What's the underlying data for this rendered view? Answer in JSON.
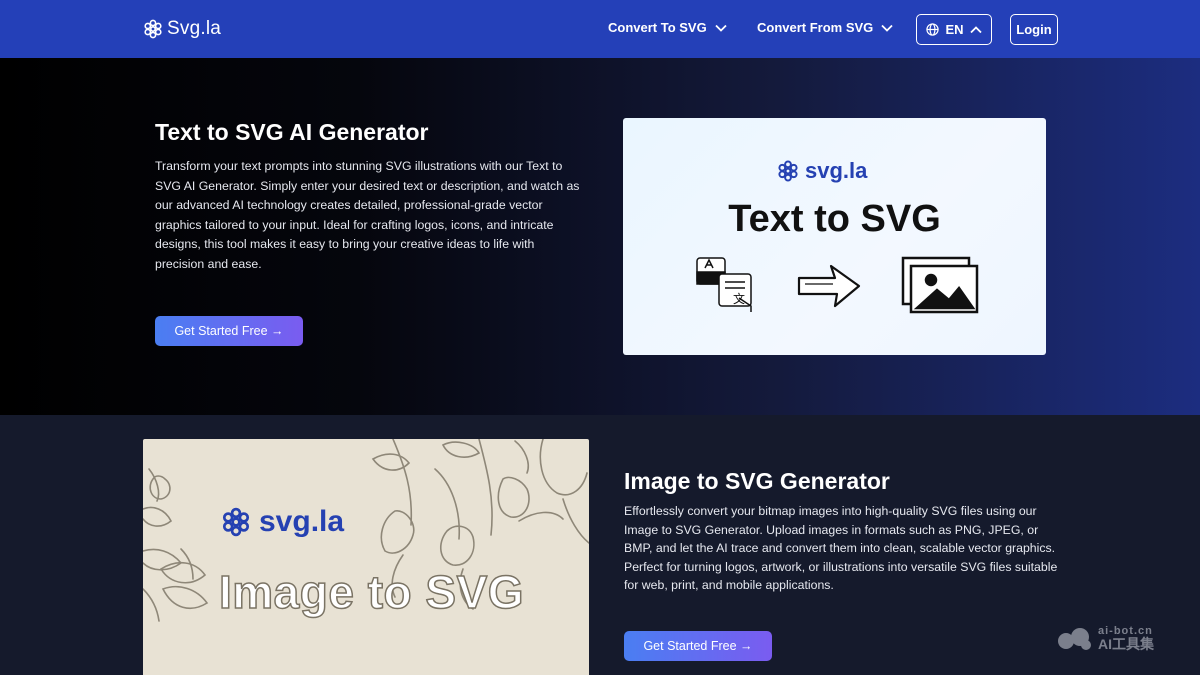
{
  "nav": {
    "logo_text": "Svg.la",
    "convert_to_label": "Convert To SVG",
    "convert_from_label": "Convert From SVG",
    "language_label": "EN",
    "login_label": "Login"
  },
  "section_text_to_svg": {
    "title": "Text to SVG AI Generator",
    "description": "Transform your text prompts into stunning SVG illustrations with our Text to SVG AI Generator. Simply enter your desired text or description, and watch as our advanced AI technology creates detailed, professional-grade vector graphics tailored to your input. Ideal for crafting logos, icons, and intricate designs, this tool makes it easy to bring your creative ideas to life with precision and ease.",
    "cta_label": "Get Started Free →",
    "image_brand": "svg.la",
    "image_title": "Text to SVG"
  },
  "section_image_to_svg": {
    "title": "Image to SVG Generator",
    "description": "Effortlessly convert your bitmap images into high-quality SVG files using our Image to SVG Generator. Upload images in formats such as PNG, JPEG, or BMP, and let the AI trace and convert them into clean, scalable vector graphics. Perfect for turning logos, artwork, or illustrations into versatile SVG files suitable for web, print, and mobile applications.",
    "cta_label": "Get Started Free →",
    "image_brand": "svg.la",
    "image_title": "Image to SVG"
  },
  "watermark": {
    "line1": "ai-bot.cn",
    "line2": "AI工具集"
  },
  "colors": {
    "nav_bg": "#2440b8",
    "brand_blue": "#2541b2",
    "cta_start": "#4a7ef2",
    "cta_end": "#7a5cf0"
  }
}
